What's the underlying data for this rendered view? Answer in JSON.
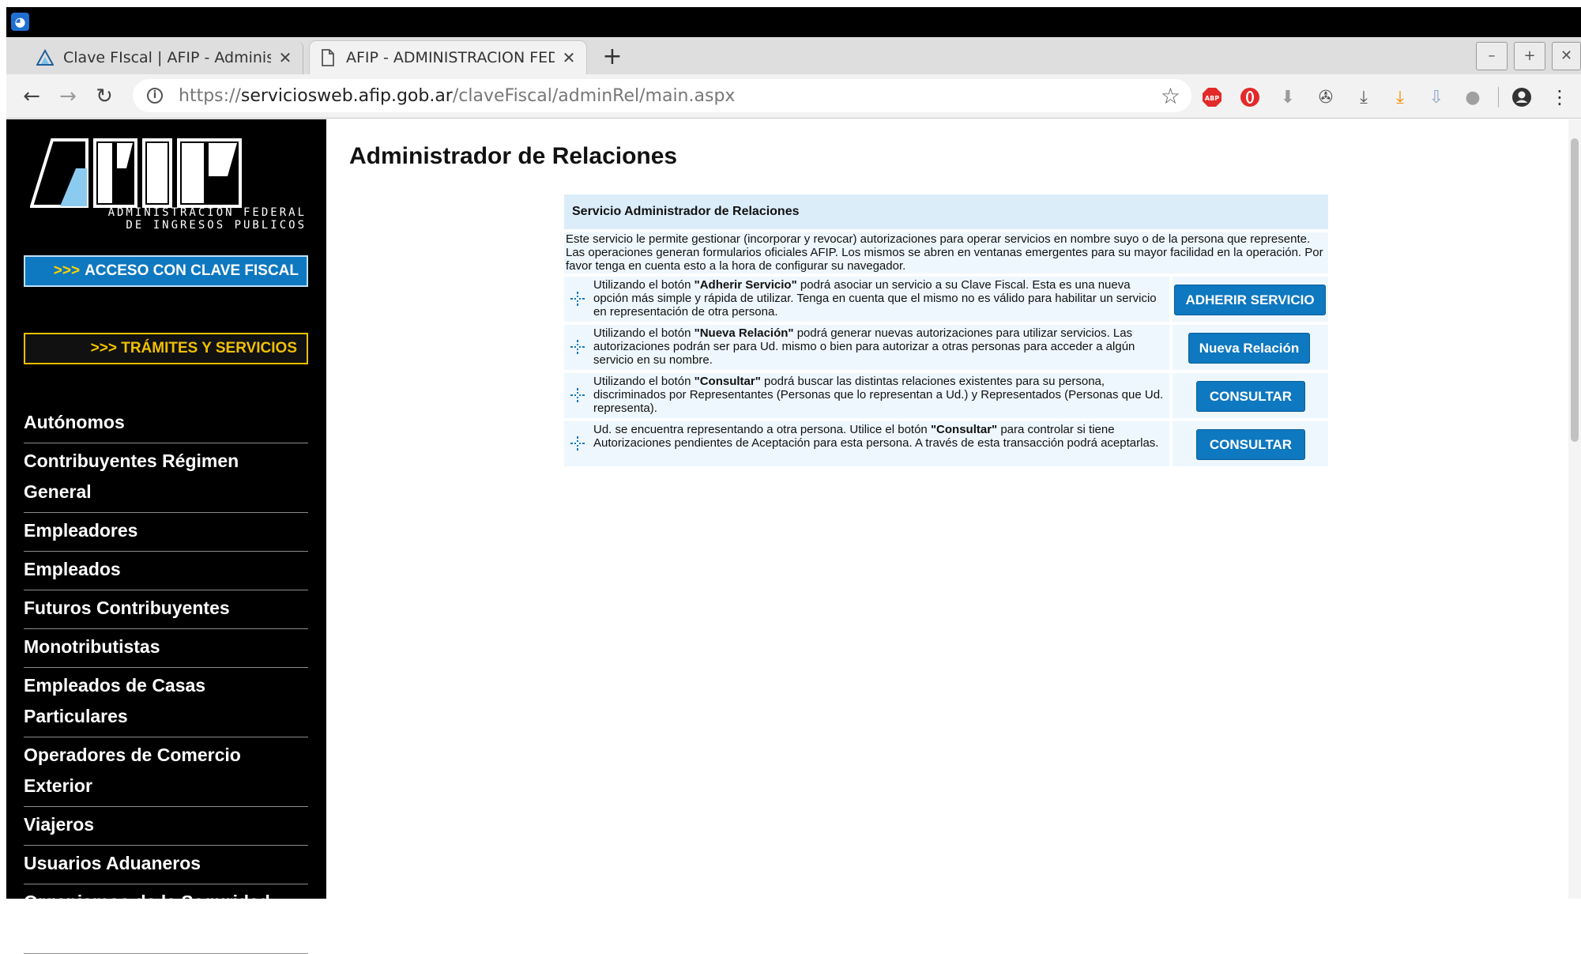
{
  "browser": {
    "tabs": [
      {
        "title": "Clave FIscal | AFIP - Administra",
        "active": false,
        "icon": "afip-triangle-icon"
      },
      {
        "title": "AFIP - ADMINISTRACION FEDE",
        "active": true,
        "icon": "page-icon"
      }
    ],
    "new_tab_label": "+",
    "address": {
      "scheme": "https://",
      "host": "serviciosweb.afip.gob.ar",
      "path": "/claveFiscal/adminRel/main.aspx"
    },
    "window_controls": [
      "minimize-icon",
      "maximize-icon",
      "close-icon"
    ],
    "extensions": [
      "adblock-icon",
      "opera-icon",
      "download-gray-icon",
      "puzzle-icon",
      "download-icon",
      "download-orange-icon",
      "download-gray2-icon",
      "chat-icon",
      "account-icon",
      "menu-icon"
    ],
    "colors": {
      "accent_blue": "#0e78c0"
    }
  },
  "sidebar": {
    "logo": {
      "letters": "AFIP",
      "line1": "ADMINISTRACION FEDERAL",
      "line2": "DE INGRESOS PUBLICOS"
    },
    "clave_fiscal": {
      "chevrons": ">>>",
      "label": "ACCESO CON CLAVE FISCAL"
    },
    "tramites": {
      "label": ">>> TRÁMITES Y SERVICIOS"
    },
    "menu": [
      "Autónomos",
      "Contribuyentes Régimen General",
      "Empleadores",
      "Empleados",
      "Futuros Contribuyentes",
      "Monotributistas",
      "Empleados de Casas Particulares",
      "Operadores de Comercio Exterior",
      "Viajeros",
      "Usuarios Aduaneros",
      "Organismos de la Seguridad Social"
    ]
  },
  "main": {
    "title": "Administrador de Relaciones",
    "panel_header": "Servicio Administrador de Relaciones",
    "intro": "Este servicio le permite gestionar (incorporar y revocar) autorizaciones para operar servicios en nombre suyo o de la persona que represente. Las operaciones generan formularios oficiales AFIP. Los mismos se abren en ventanas emergentes para su mayor facilidad en la operación. Por favor tenga en cuenta esto a la hora de configurar su navegador.",
    "rows": [
      {
        "pre": "Utilizando el botón ",
        "bold": "\"Adherir Servicio\"",
        "post": " podrá asociar un servicio a su Clave Fiscal. Esta es una nueva opción más simple y rápida de utilizar. Tenga en cuenta que el mismo no es válido para habilitar un servicio en representación de otra persona.",
        "button": "ADHERIR SERVICIO"
      },
      {
        "pre": "Utilizando el botón ",
        "bold": "\"Nueva Relación\"",
        "post": " podrá generar nuevas autorizaciones para utilizar servicios. Las autorizaciones podrán ser para Ud. mismo o bien para autorizar a otras personas para acceder a algún servicio en su nombre.",
        "button": "Nueva Relación"
      },
      {
        "pre": "Utilizando el botón ",
        "bold": "\"Consultar\"",
        "post": " podrá buscar las distintas relaciones existentes para su persona, discriminados por Representantes (Personas que lo representan a Ud.) y Representados (Personas que Ud. representa).",
        "button": "CONSULTAR"
      },
      {
        "pre": "Ud. se encuentra representando a otra persona. Utilice el botón ",
        "bold": "\"Consultar\"",
        "post": " para controlar si tiene Autorizaciones pendientes de Aceptación para esta persona. A través de esta transacción podrá aceptarlas.",
        "button": "CONSULTAR"
      }
    ]
  }
}
